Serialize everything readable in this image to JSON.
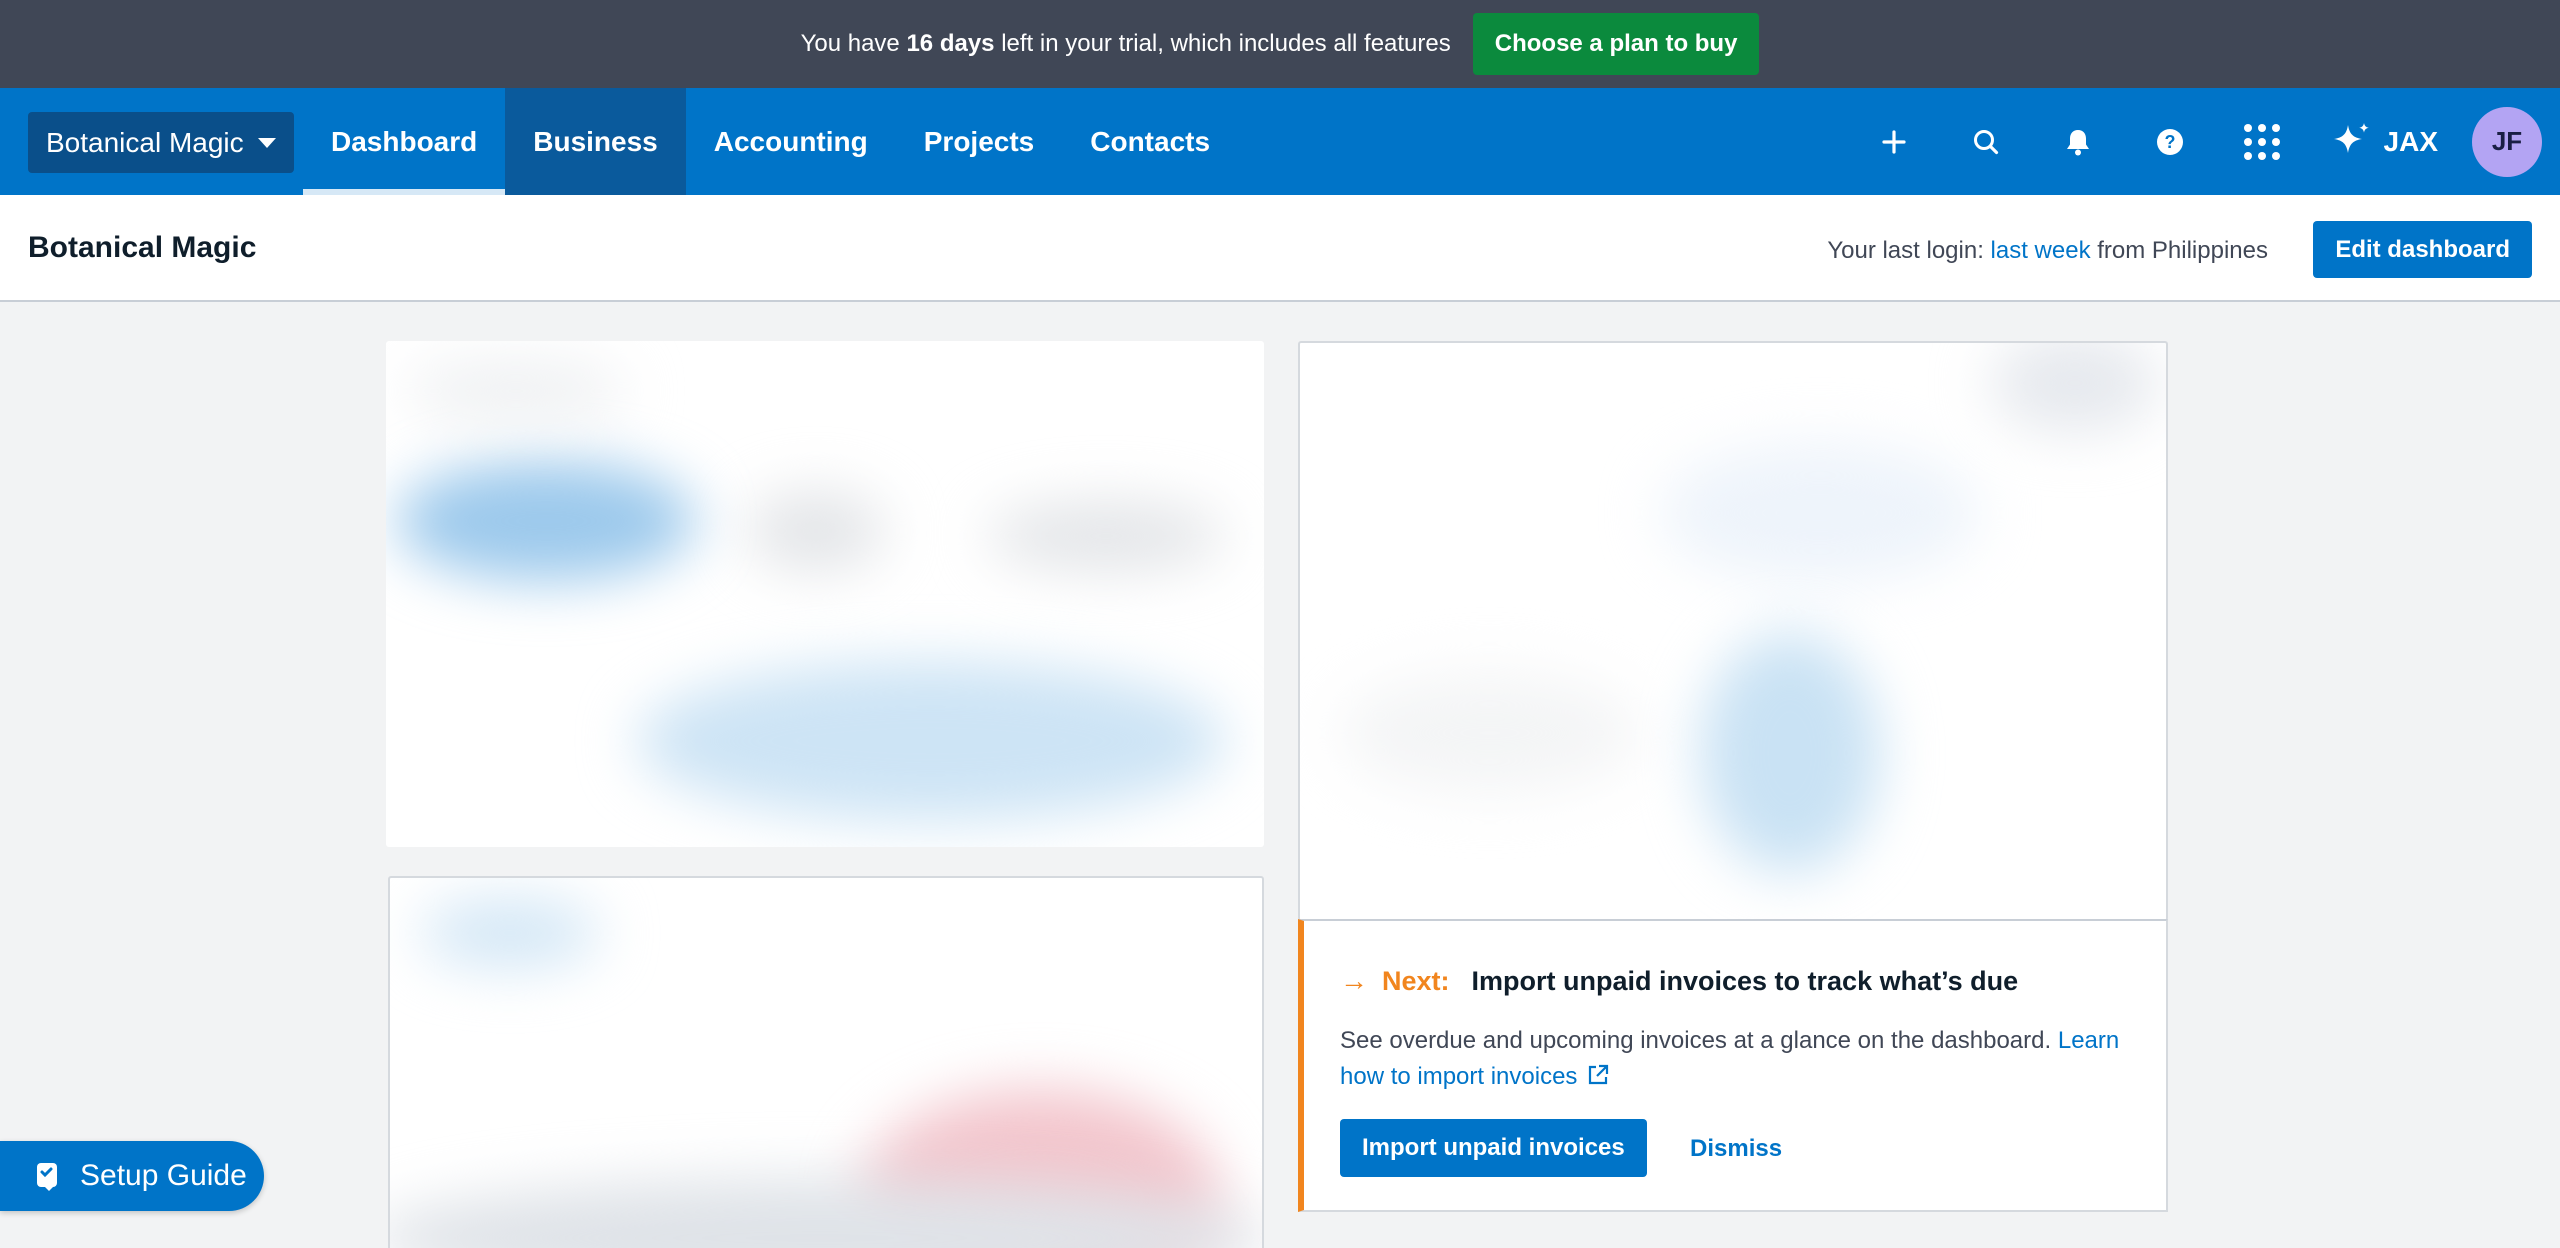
{
  "trial_banner": {
    "text_before": "You have ",
    "days": "16 days",
    "text_after": " left in your trial, which includes all features",
    "cta": "Choose a plan to buy"
  },
  "nav": {
    "org_name": "Botanical Magic",
    "tabs": [
      "Dashboard",
      "Business",
      "Accounting",
      "Projects",
      "Contacts"
    ],
    "active_tab": "Dashboard",
    "icons": [
      "plus-icon",
      "search-icon",
      "bell-icon",
      "help-icon",
      "app-grid-icon",
      "sparkle-icon"
    ],
    "assistant_label": "JAX",
    "avatar_initials": "JF"
  },
  "subheader": {
    "title": "Botanical Magic",
    "login_prefix": "Your last login: ",
    "login_when": "last week",
    "login_suffix": " from Philippines",
    "edit_button": "Edit dashboard"
  },
  "next_step": {
    "label": "Next:",
    "title": "Import unpaid invoices to track what’s due",
    "description": "See overdue and upcoming invoices at a glance on the dashboard. ",
    "link": "Learn how to import invoices",
    "primary_button": "Import unpaid invoices",
    "dismiss": "Dismiss"
  },
  "setup_guide": {
    "label": "Setup Guide"
  },
  "colors": {
    "banner_bg": "#404756",
    "cta_green": "#0b8a3d",
    "nav_blue": "#0074c8",
    "accent_orange": "#f1851e"
  }
}
